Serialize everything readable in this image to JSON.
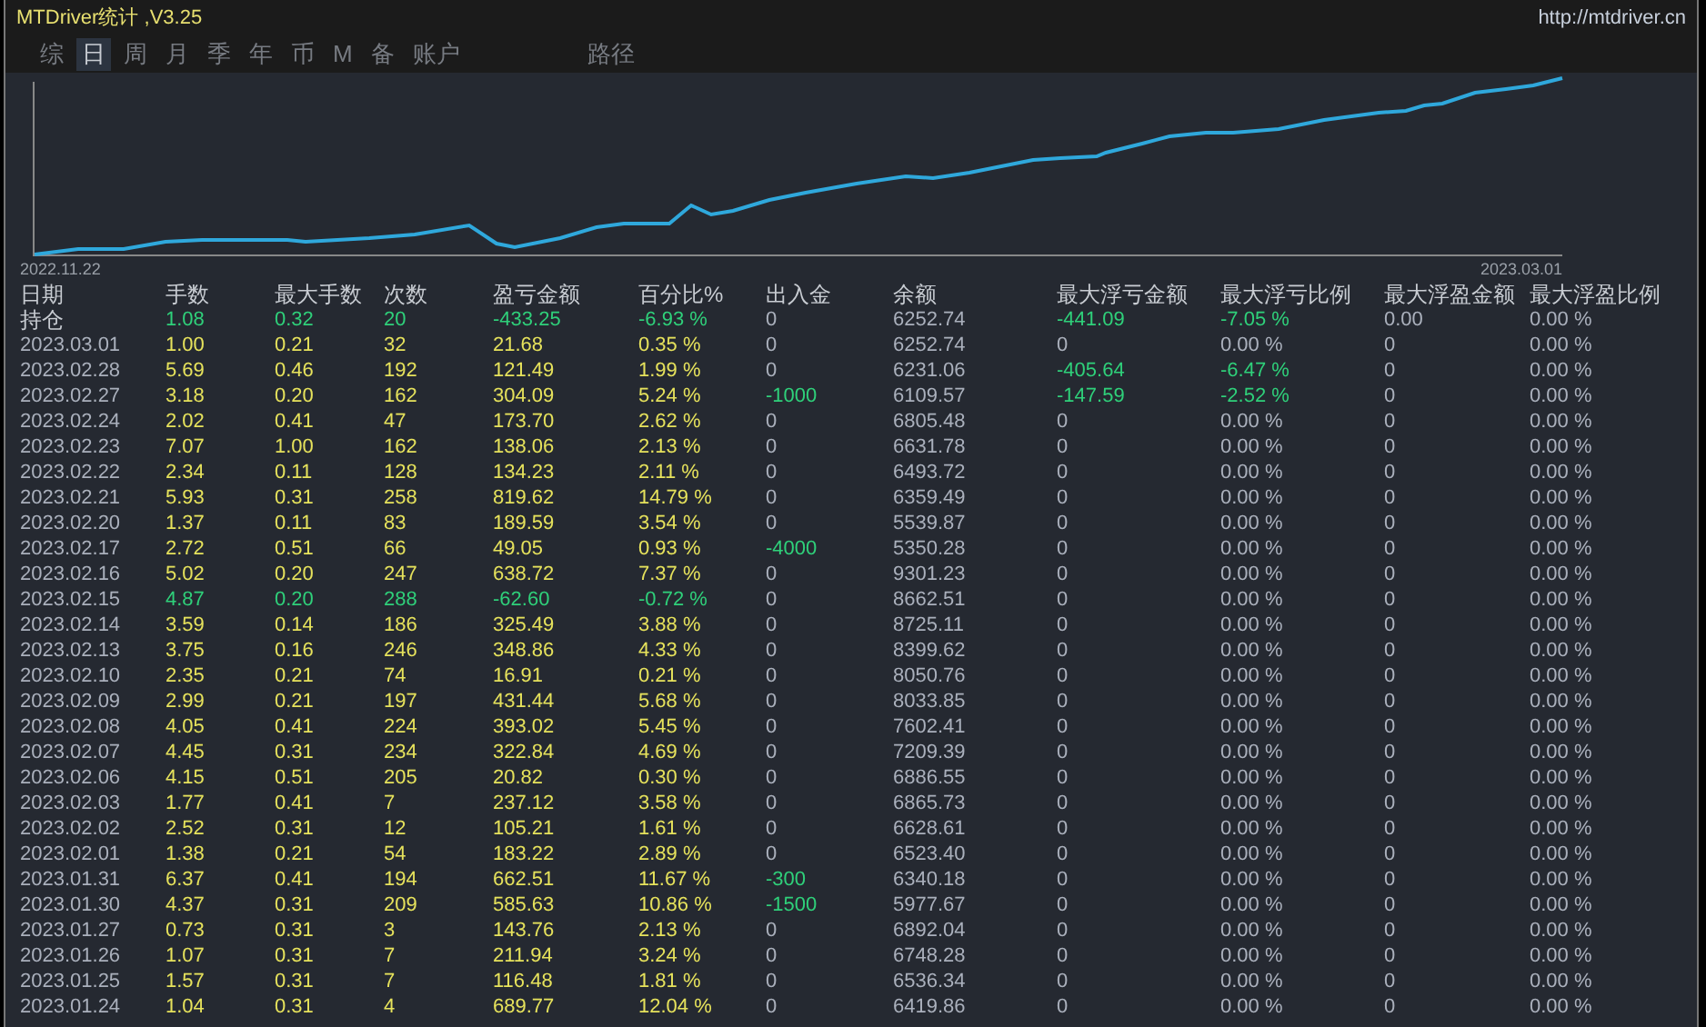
{
  "window": {
    "title": "MTDriver统计 ,V3.25",
    "url": "http://mtdriver.cn"
  },
  "tabs": [
    {
      "label": "综",
      "selected": false
    },
    {
      "label": "日",
      "selected": true
    },
    {
      "label": "周",
      "selected": false
    },
    {
      "label": "月",
      "selected": false
    },
    {
      "label": "季",
      "selected": false
    },
    {
      "label": "年",
      "selected": false
    },
    {
      "label": "币",
      "selected": false
    },
    {
      "label": "M",
      "selected": false
    },
    {
      "label": "备",
      "selected": false
    },
    {
      "label": "账户",
      "selected": false
    },
    {
      "label": "路径",
      "selected": false
    }
  ],
  "chart": {
    "start_label": "2022.11.22",
    "end_label": "2023.03.01"
  },
  "table": {
    "columns": [
      "日期",
      "手数",
      "最大手数",
      "次数",
      "盈亏金额",
      "百分比%",
      "出入金",
      "余额",
      "最大浮亏金额",
      "最大浮亏比例",
      "最大浮盈金额",
      "最大浮盈比例"
    ],
    "rows": [
      {
        "cells": [
          "持仓",
          "1.08",
          "0.32",
          "20",
          "-433.25",
          "-6.93 %",
          "0",
          "6252.74",
          "-441.09",
          "-7.05 %",
          "0.00",
          "0.00 %"
        ],
        "loss": true,
        "withdrawal": false,
        "floating_loss": true
      },
      {
        "cells": [
          "2023.03.01",
          "1.00",
          "0.21",
          "32",
          "21.68",
          "0.35 %",
          "0",
          "6252.74",
          "0",
          "0.00 %",
          "0",
          "0.00 %"
        ],
        "loss": false,
        "withdrawal": false,
        "floating_loss": false
      },
      {
        "cells": [
          "2023.02.28",
          "5.69",
          "0.46",
          "192",
          "121.49",
          "1.99 %",
          "0",
          "6231.06",
          "-405.64",
          "-6.47 %",
          "0",
          "0.00 %"
        ],
        "loss": false,
        "withdrawal": false,
        "floating_loss": true
      },
      {
        "cells": [
          "2023.02.27",
          "3.18",
          "0.20",
          "162",
          "304.09",
          "5.24 %",
          "-1000",
          "6109.57",
          "-147.59",
          "-2.52 %",
          "0",
          "0.00 %"
        ],
        "loss": false,
        "withdrawal": true,
        "floating_loss": true
      },
      {
        "cells": [
          "2023.02.24",
          "2.02",
          "0.41",
          "47",
          "173.70",
          "2.62 %",
          "0",
          "6805.48",
          "0",
          "0.00 %",
          "0",
          "0.00 %"
        ],
        "loss": false,
        "withdrawal": false,
        "floating_loss": false
      },
      {
        "cells": [
          "2023.02.23",
          "7.07",
          "1.00",
          "162",
          "138.06",
          "2.13 %",
          "0",
          "6631.78",
          "0",
          "0.00 %",
          "0",
          "0.00 %"
        ],
        "loss": false,
        "withdrawal": false,
        "floating_loss": false
      },
      {
        "cells": [
          "2023.02.22",
          "2.34",
          "0.11",
          "128",
          "134.23",
          "2.11 %",
          "0",
          "6493.72",
          "0",
          "0.00 %",
          "0",
          "0.00 %"
        ],
        "loss": false,
        "withdrawal": false,
        "floating_loss": false
      },
      {
        "cells": [
          "2023.02.21",
          "5.93",
          "0.31",
          "258",
          "819.62",
          "14.79 %",
          "0",
          "6359.49",
          "0",
          "0.00 %",
          "0",
          "0.00 %"
        ],
        "loss": false,
        "withdrawal": false,
        "floating_loss": false
      },
      {
        "cells": [
          "2023.02.20",
          "1.37",
          "0.11",
          "83",
          "189.59",
          "3.54 %",
          "0",
          "5539.87",
          "0",
          "0.00 %",
          "0",
          "0.00 %"
        ],
        "loss": false,
        "withdrawal": false,
        "floating_loss": false
      },
      {
        "cells": [
          "2023.02.17",
          "2.72",
          "0.51",
          "66",
          "49.05",
          "0.93 %",
          "-4000",
          "5350.28",
          "0",
          "0.00 %",
          "0",
          "0.00 %"
        ],
        "loss": false,
        "withdrawal": true,
        "floating_loss": false
      },
      {
        "cells": [
          "2023.02.16",
          "5.02",
          "0.20",
          "247",
          "638.72",
          "7.37 %",
          "0",
          "9301.23",
          "0",
          "0.00 %",
          "0",
          "0.00 %"
        ],
        "loss": false,
        "withdrawal": false,
        "floating_loss": false
      },
      {
        "cells": [
          "2023.02.15",
          "4.87",
          "0.20",
          "288",
          "-62.60",
          "-0.72 %",
          "0",
          "8662.51",
          "0",
          "0.00 %",
          "0",
          "0.00 %"
        ],
        "loss": true,
        "withdrawal": false,
        "floating_loss": false
      },
      {
        "cells": [
          "2023.02.14",
          "3.59",
          "0.14",
          "186",
          "325.49",
          "3.88 %",
          "0",
          "8725.11",
          "0",
          "0.00 %",
          "0",
          "0.00 %"
        ],
        "loss": false,
        "withdrawal": false,
        "floating_loss": false
      },
      {
        "cells": [
          "2023.02.13",
          "3.75",
          "0.16",
          "246",
          "348.86",
          "4.33 %",
          "0",
          "8399.62",
          "0",
          "0.00 %",
          "0",
          "0.00 %"
        ],
        "loss": false,
        "withdrawal": false,
        "floating_loss": false
      },
      {
        "cells": [
          "2023.02.10",
          "2.35",
          "0.21",
          "74",
          "16.91",
          "0.21 %",
          "0",
          "8050.76",
          "0",
          "0.00 %",
          "0",
          "0.00 %"
        ],
        "loss": false,
        "withdrawal": false,
        "floating_loss": false
      },
      {
        "cells": [
          "2023.02.09",
          "2.99",
          "0.21",
          "197",
          "431.44",
          "5.68 %",
          "0",
          "8033.85",
          "0",
          "0.00 %",
          "0",
          "0.00 %"
        ],
        "loss": false,
        "withdrawal": false,
        "floating_loss": false
      },
      {
        "cells": [
          "2023.02.08",
          "4.05",
          "0.41",
          "224",
          "393.02",
          "5.45 %",
          "0",
          "7602.41",
          "0",
          "0.00 %",
          "0",
          "0.00 %"
        ],
        "loss": false,
        "withdrawal": false,
        "floating_loss": false
      },
      {
        "cells": [
          "2023.02.07",
          "4.45",
          "0.31",
          "234",
          "322.84",
          "4.69 %",
          "0",
          "7209.39",
          "0",
          "0.00 %",
          "0",
          "0.00 %"
        ],
        "loss": false,
        "withdrawal": false,
        "floating_loss": false
      },
      {
        "cells": [
          "2023.02.06",
          "4.15",
          "0.51",
          "205",
          "20.82",
          "0.30 %",
          "0",
          "6886.55",
          "0",
          "0.00 %",
          "0",
          "0.00 %"
        ],
        "loss": false,
        "withdrawal": false,
        "floating_loss": false
      },
      {
        "cells": [
          "2023.02.03",
          "1.77",
          "0.41",
          "7",
          "237.12",
          "3.58 %",
          "0",
          "6865.73",
          "0",
          "0.00 %",
          "0",
          "0.00 %"
        ],
        "loss": false,
        "withdrawal": false,
        "floating_loss": false
      },
      {
        "cells": [
          "2023.02.02",
          "2.52",
          "0.31",
          "12",
          "105.21",
          "1.61 %",
          "0",
          "6628.61",
          "0",
          "0.00 %",
          "0",
          "0.00 %"
        ],
        "loss": false,
        "withdrawal": false,
        "floating_loss": false
      },
      {
        "cells": [
          "2023.02.01",
          "1.38",
          "0.21",
          "54",
          "183.22",
          "2.89 %",
          "0",
          "6523.40",
          "0",
          "0.00 %",
          "0",
          "0.00 %"
        ],
        "loss": false,
        "withdrawal": false,
        "floating_loss": false
      },
      {
        "cells": [
          "2023.01.31",
          "6.37",
          "0.41",
          "194",
          "662.51",
          "11.67 %",
          "-300",
          "6340.18",
          "0",
          "0.00 %",
          "0",
          "0.00 %"
        ],
        "loss": false,
        "withdrawal": true,
        "floating_loss": false
      },
      {
        "cells": [
          "2023.01.30",
          "4.37",
          "0.31",
          "209",
          "585.63",
          "10.86 %",
          "-1500",
          "5977.67",
          "0",
          "0.00 %",
          "0",
          "0.00 %"
        ],
        "loss": false,
        "withdrawal": true,
        "floating_loss": false
      },
      {
        "cells": [
          "2023.01.27",
          "0.73",
          "0.31",
          "3",
          "143.76",
          "2.13 %",
          "0",
          "6892.04",
          "0",
          "0.00 %",
          "0",
          "0.00 %"
        ],
        "loss": false,
        "withdrawal": false,
        "floating_loss": false
      },
      {
        "cells": [
          "2023.01.26",
          "1.07",
          "0.31",
          "7",
          "211.94",
          "3.24 %",
          "0",
          "6748.28",
          "0",
          "0.00 %",
          "0",
          "0.00 %"
        ],
        "loss": false,
        "withdrawal": false,
        "floating_loss": false
      },
      {
        "cells": [
          "2023.01.25",
          "1.57",
          "0.31",
          "7",
          "116.48",
          "1.81 %",
          "0",
          "6536.34",
          "0",
          "0.00 %",
          "0",
          "0.00 %"
        ],
        "loss": false,
        "withdrawal": false,
        "floating_loss": false
      },
      {
        "cells": [
          "2023.01.24",
          "1.04",
          "0.31",
          "4",
          "689.77",
          "12.04 %",
          "0",
          "6419.86",
          "0",
          "0.00 %",
          "0",
          "0.00 %"
        ],
        "loss": false,
        "withdrawal": false,
        "floating_loss": false
      }
    ]
  }
}
